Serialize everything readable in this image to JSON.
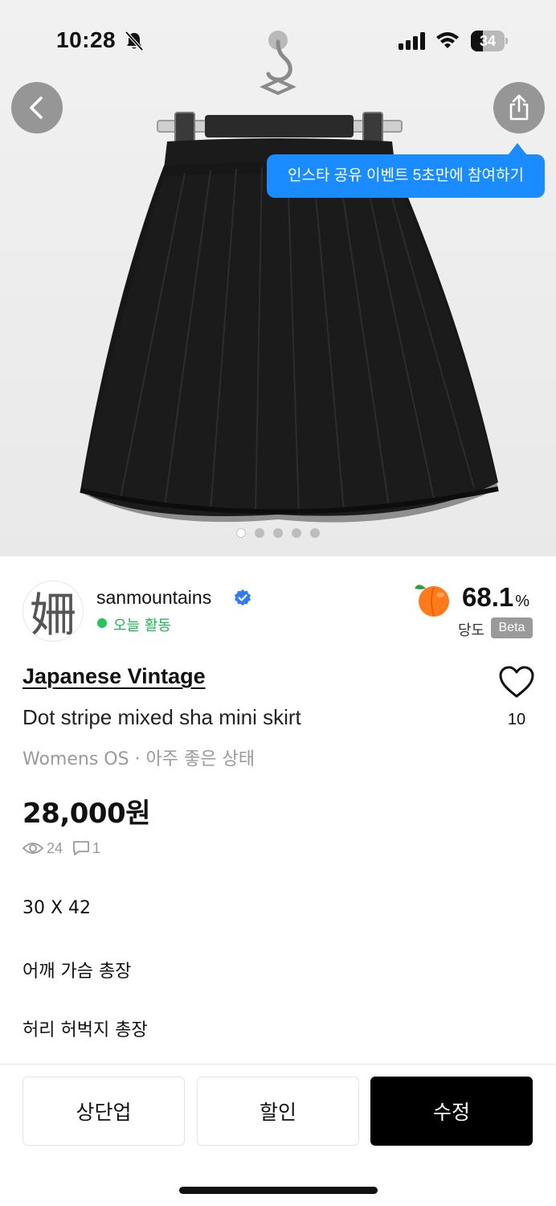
{
  "status_bar": {
    "time": "10:28",
    "battery": "34",
    "icons": [
      "bell-slash-icon",
      "signal-icon",
      "wifi-icon",
      "battery-icon"
    ]
  },
  "gallery": {
    "image_subject": "skirt-photo",
    "page_count": 5,
    "active_index": 0
  },
  "nav": {
    "back_icon": "chevron-left-icon",
    "share_icon": "share-icon"
  },
  "share_tooltip": "인스타 공유 이벤트 5초만에 참여하기",
  "seller": {
    "name": "sanmountains",
    "avatar_glyph": "姍",
    "verified_icon": "verified-badge-icon",
    "activity": "오늘 활동",
    "score_value": "68.1",
    "score_unit": "%",
    "score_label": "당도",
    "score_badge": "Beta",
    "score_icon": "peach-icon"
  },
  "product": {
    "brand": "Japanese Vintage",
    "title": "Dot stripe mixed sha mini skirt",
    "meta": "Womens OS · 아주 좋은 상태",
    "likes": "10",
    "price": "28,000원",
    "views": "24",
    "comments": "1",
    "description": [
      "30 X 42",
      "어깨 가슴 총장",
      "허리 허벅지 총장"
    ]
  },
  "actions": {
    "bump": "상단업",
    "discount": "할인",
    "edit": "수정"
  },
  "colors": {
    "accent_blue": "#1a8cff",
    "active_green": "#22c55e",
    "verified_blue": "#2f7cf6",
    "peach": "#ff7a1a"
  }
}
